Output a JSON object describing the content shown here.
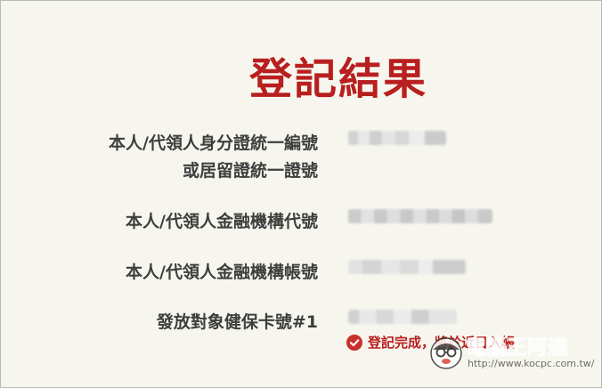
{
  "page": {
    "title": "登記結果"
  },
  "fields": [
    {
      "label_line1": "本人/代領人身分證統一編號",
      "label_line2": "或居留證統一證號"
    },
    {
      "label": "本人/代領人金融機構代號"
    },
    {
      "label": "本人/代領人金融機構帳號"
    },
    {
      "label": "發放對象健保卡號#1"
    }
  ],
  "status": {
    "message": "登記完成，將於近日入帳",
    "color": "#b81f1f"
  },
  "watermark": {
    "name": "電腦王阿達",
    "url": "http://www.kocpc.com.tw/"
  },
  "colors": {
    "accent": "#b81f1f",
    "background": "#f7f6ee",
    "label_text": "#3e3e3e"
  }
}
